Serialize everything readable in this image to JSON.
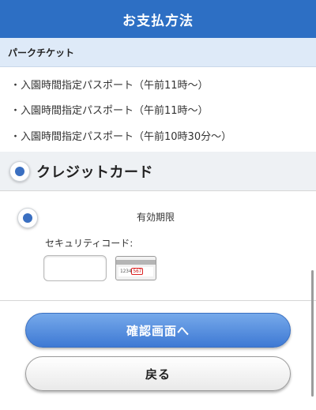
{
  "header": {
    "title": "お支払方法"
  },
  "park_ticket": {
    "heading": "パークチケット",
    "items": [
      "・入園時間指定パスポート（午前11時〜）",
      "・入園時間指定パスポート（午前11時〜）",
      "・入園時間指定パスポート（午前10時30分〜）"
    ]
  },
  "credit_card": {
    "title": "クレジットカード",
    "selected": true,
    "expiry_label": "有効期限",
    "security_code_label": "セキュリティコード:",
    "security_code_value": "",
    "card_sample": {
      "digits": "1234",
      "cvv": "567"
    }
  },
  "buttons": {
    "confirm_label": "確認画面へ",
    "back_label": "戻る"
  },
  "colors": {
    "header_bg": "#2d6fc4",
    "section_bg": "#deeaf8",
    "accent": "#3a6fc1"
  }
}
